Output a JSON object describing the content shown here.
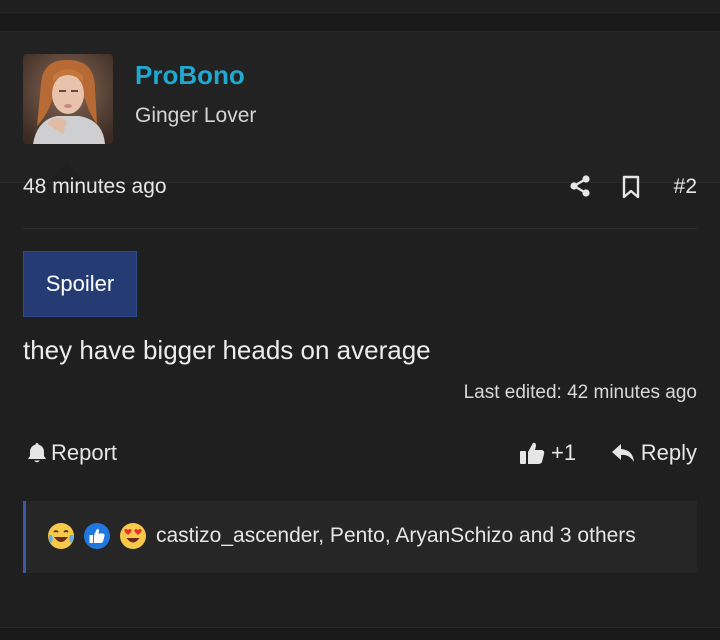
{
  "author": {
    "username": "ProBono",
    "title": "Ginger Lover"
  },
  "post": {
    "timestamp": "48 minutes ago",
    "number": "#2",
    "spoiler_label": "Spoiler",
    "body": "they have bigger heads on average",
    "last_edited": "Last edited: 42 minutes ago"
  },
  "actions": {
    "report_label": "Report",
    "like_label": "+1",
    "reply_label": "Reply"
  },
  "reactions": {
    "icons": [
      "crying-laugh-emoji",
      "like-emoji",
      "heart-eyes-emoji"
    ],
    "reactors": "castizo_ascender, Pento, AryanSchizo and 3 others"
  },
  "colors": {
    "username": "#1fa8d0",
    "spoiler_bg": "#243c73",
    "reaction_border": "#3b57a6"
  }
}
